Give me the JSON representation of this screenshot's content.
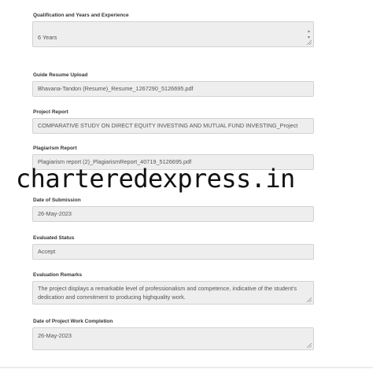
{
  "qualification": {
    "label": "Qualification and Years and Experience",
    "value": "6 Years"
  },
  "guide_resume": {
    "label": "Guide Resume Upload",
    "value": "Bhavana-Tandon (Resume)_Resume_1267290_5126695.pdf"
  },
  "project_report": {
    "label": "Project Report",
    "value": "COMPARATIVE STUDY ON DIRECT EQUITY INVESTING AND MUTUAL FUND INVESTING_Project"
  },
  "plagiarism_report": {
    "label": "Plagiarism Report",
    "value": "Plagiarism report (2)_PlagiarismReport_40719_5126695.pdf"
  },
  "date_submission": {
    "label": "Date of Submission",
    "value": "26-May-2023"
  },
  "evaluated_status": {
    "label": "Evaluated Status",
    "value": "Accept"
  },
  "evaluation_remarks": {
    "label": "Evaluation Remarks",
    "value": "The project displays a remarkable level of professionalism and competence, indicative of the student's dedication and commitment to producing highquality work."
  },
  "date_completion": {
    "label": "Date of Project Work Completion",
    "value": "26-May-2023"
  },
  "watermark": {
    "text": "charteredexpress.in"
  },
  "icons": {
    "scroll_up": "chevron-up-icon",
    "scroll_down": "chevron-down-icon",
    "resize": "resize-grip-icon"
  }
}
